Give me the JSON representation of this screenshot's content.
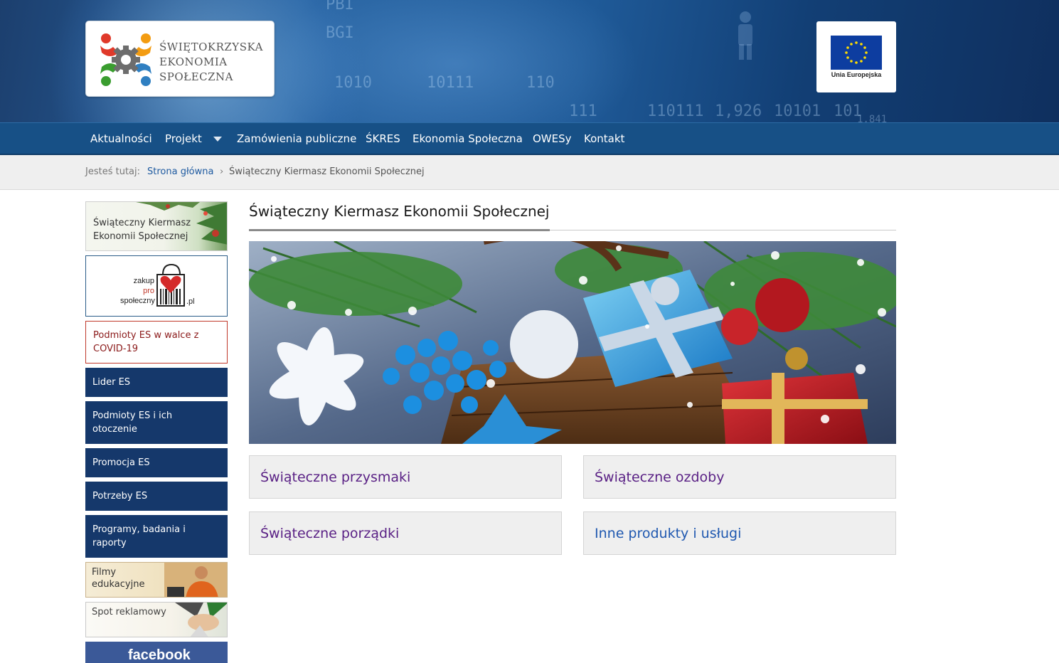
{
  "header": {
    "logo": {
      "line1": "ŚWIĘTOKRZYSKA",
      "line2": "EKONOMIA",
      "line3": "SPOŁECZNA"
    },
    "eu_label": "Unia Europejska",
    "bg_numbers": [
      "PBI",
      "BGI",
      "10111",
      "110",
      "1010",
      "111",
      "110111",
      "1,926",
      "10101",
      "101",
      "1,841"
    ]
  },
  "nav": {
    "items": [
      "Aktualności",
      "Projekt",
      "Zamówienia publiczne",
      "ŚKRES",
      "Ekonomia Społeczna",
      "OWESy",
      "Kontakt"
    ]
  },
  "breadcrumb": {
    "prefix": "Jesteś tutaj:",
    "home": "Strona główna",
    "separator": "›",
    "current": "Świąteczny Kiermasz Ekonomii Społecznej"
  },
  "sidebar": {
    "xmas": "Świąteczny Kiermasz Ekonomii Społecznej",
    "zakup": {
      "word1": "zakup",
      "word2": "pro",
      "word3": "społeczny",
      "domain": ".pl"
    },
    "covid": "Podmioty ES w walce z COVID-19",
    "blue_items": [
      "Lider ES",
      "Podmioty ES i ich otoczenie",
      "Promocja ES",
      "Potrzeby ES",
      "Programy, badania i raporty"
    ],
    "film": "Filmy edukacyjne",
    "spot": "Spot reklamowy",
    "facebook": "facebook"
  },
  "main": {
    "title": "Świąteczny Kiermasz Ekonomii Społecznej",
    "tiles": [
      {
        "label": "Świąteczne przysmaki"
      },
      {
        "label": "Świąteczne ozdoby"
      },
      {
        "label": "Świąteczne porządki"
      },
      {
        "label": "Inne produkty i usługi"
      }
    ]
  },
  "colors": {
    "nav_bg": "#175086",
    "tile_purple": "#5a2185",
    "tile_blue": "#1f58b0",
    "link": "#1e5aa0",
    "sidebar_blue": "#15386b",
    "covid_red": "#c0392b"
  }
}
